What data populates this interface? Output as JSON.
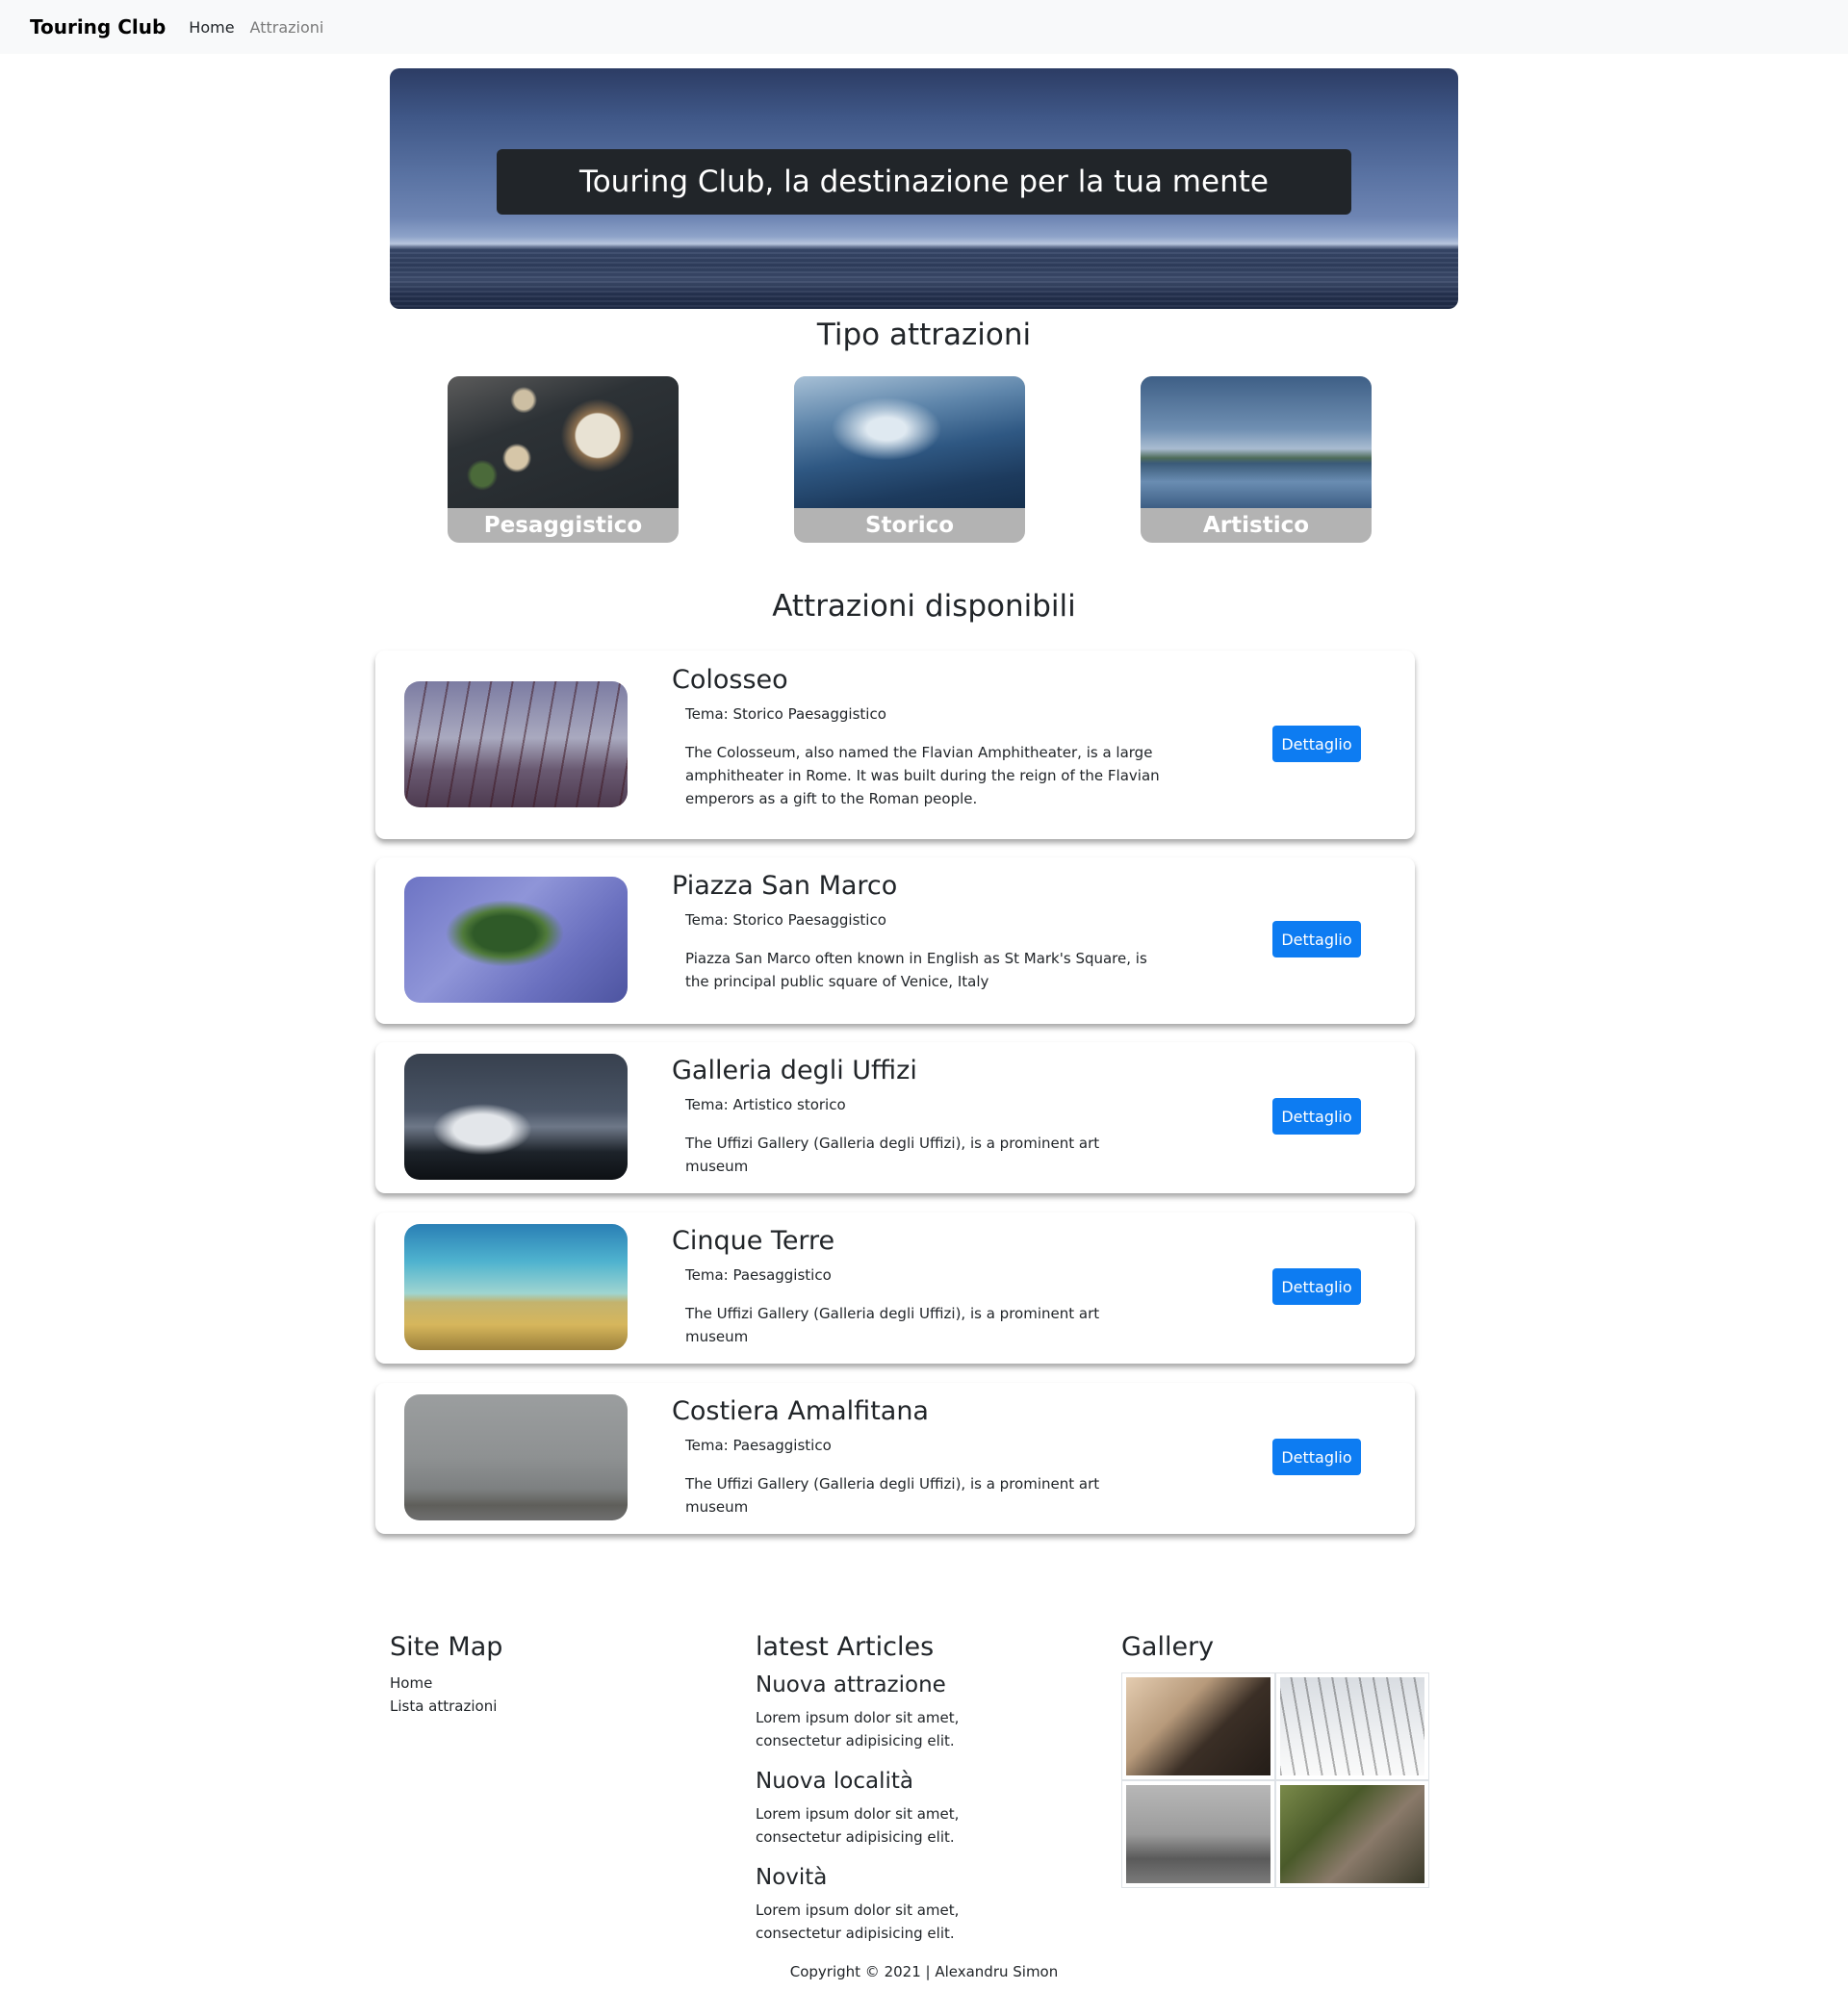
{
  "navbar": {
    "brand": "Touring Club",
    "links": [
      {
        "label": "Home"
      },
      {
        "label": "Attrazioni"
      }
    ]
  },
  "hero": {
    "text": "Touring Club, la destinazione per la tua mente"
  },
  "categories": {
    "title": "Tipo attrazioni",
    "items": [
      {
        "label": "Pesaggistico"
      },
      {
        "label": "Storico"
      },
      {
        "label": "Artistico"
      }
    ]
  },
  "attractions": {
    "title": "Attrazioni disponibili",
    "button_label": "Dettaglio",
    "items": [
      {
        "title": "Colosseo",
        "tema": "Tema: Storico Paesaggistico",
        "description": "The Colosseum, also named the Flavian Amphitheater, is a large amphitheater in Rome. It was built during the reign of the Flavian emperors as a gift to the Roman people."
      },
      {
        "title": "Piazza San Marco",
        "tema": "Tema: Storico Paesaggistico",
        "description": "Piazza San Marco often known in English as St Mark's Square, is the principal public square of Venice, Italy"
      },
      {
        "title": "Galleria degli Uffizi",
        "tema": "Tema: Artistico storico",
        "description": "The Uffizi Gallery (Galleria degli Uffizi), is a prominent art museum"
      },
      {
        "title": "Cinque Terre",
        "tema": "Tema: Paesaggistico",
        "description": "The Uffizi Gallery (Galleria degli Uffizi), is a prominent art museum"
      },
      {
        "title": "Costiera Amalfitana",
        "tema": "Tema: Paesaggistico",
        "description": "The Uffizi Gallery (Galleria degli Uffizi), is a prominent art museum"
      }
    ]
  },
  "footer": {
    "sitemap": {
      "title": "Site Map",
      "links": [
        "Home",
        "Lista attrazioni"
      ]
    },
    "articles": {
      "title": "latest Articles",
      "items": [
        {
          "title": "Nuova attrazione",
          "text": "Lorem ipsum dolor sit amet, consectetur adipisicing elit."
        },
        {
          "title": "Nuova località",
          "text": "Lorem ipsum dolor sit amet, consectetur adipisicing elit."
        },
        {
          "title": "Novità",
          "text": "Lorem ipsum dolor sit amet, consectetur adipisicing elit."
        }
      ]
    },
    "gallery": {
      "title": "Gallery"
    },
    "copyright": "Copyright © 2021 | Alexandru Simon"
  },
  "colors": {
    "button": "#0d7cf2",
    "navbar_bg": "#f8f9fa",
    "hero_box": "#212529",
    "category_label_bg": "#b3b3b3"
  }
}
